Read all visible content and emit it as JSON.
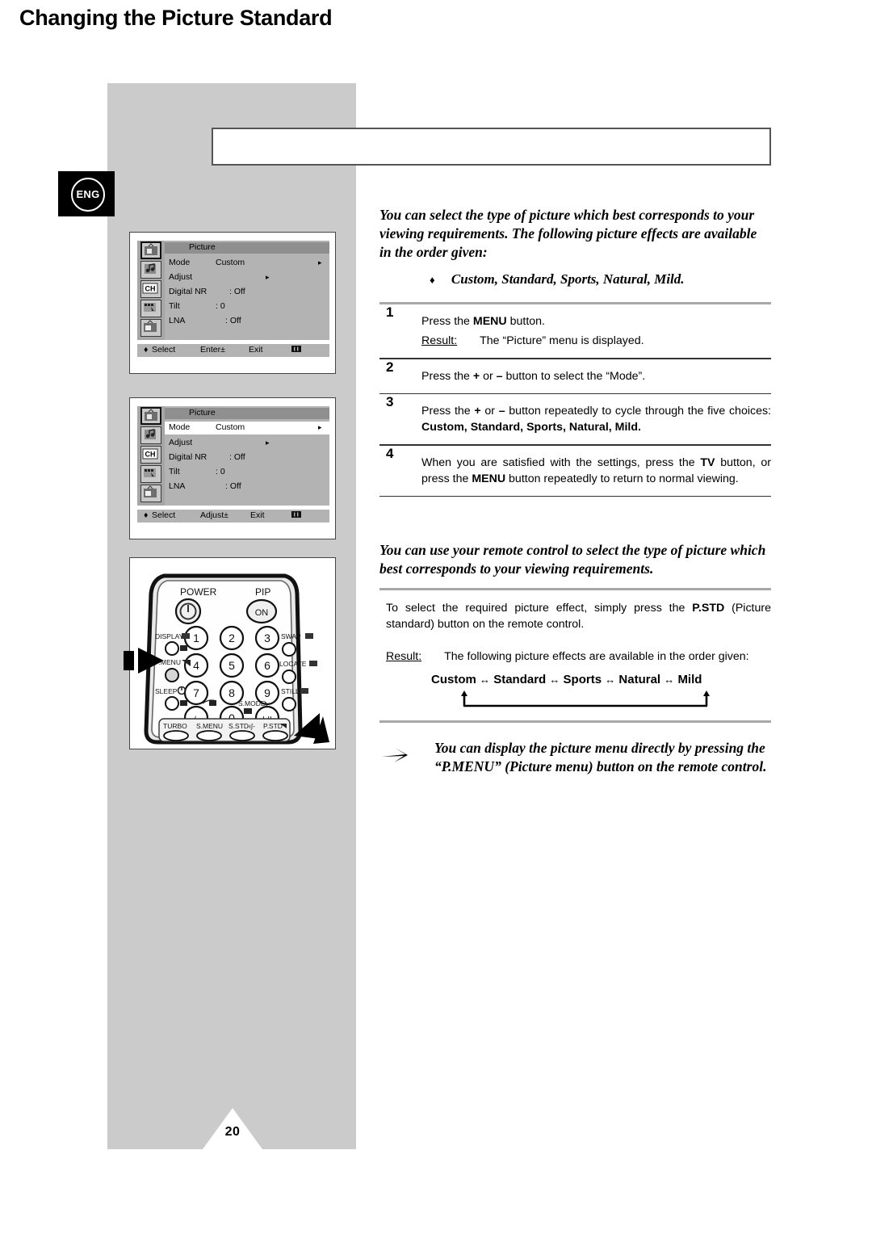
{
  "page": {
    "number": "20",
    "language_badge": "ENG",
    "title": "Changing the Picture Standard"
  },
  "osd_menu_1": {
    "title": "Picture",
    "icons": [
      "picture-icon",
      "sound-icon",
      "channel-icon",
      "function-icon",
      "pip-icon"
    ],
    "rows": [
      {
        "label": "Mode",
        "value": "Custom",
        "arrow": "▸",
        "highlighted": false
      },
      {
        "label": "Adjust",
        "value": "",
        "arrow": "▸",
        "highlighted": false
      },
      {
        "label": "Digital NR",
        "value": ": Off",
        "arrow": "",
        "highlighted": false
      },
      {
        "label": "Tilt",
        "value": ": 0",
        "arrow": "",
        "highlighted": false
      },
      {
        "label": "LNA",
        "value": ": Off",
        "arrow": "",
        "highlighted": false
      }
    ],
    "footer": {
      "select": "Select",
      "action": "Enter±",
      "exit": "Exit"
    }
  },
  "osd_menu_2": {
    "title": "Picture",
    "icons": [
      "picture-icon",
      "sound-icon",
      "channel-icon",
      "function-icon",
      "pip-icon"
    ],
    "rows": [
      {
        "label": "Mode",
        "value": "Custom",
        "arrow": "▸",
        "highlighted": true
      },
      {
        "label": "Adjust",
        "value": "",
        "arrow": "▸",
        "highlighted": false
      },
      {
        "label": "Digital NR",
        "value": ": Off",
        "arrow": "",
        "highlighted": false
      },
      {
        "label": "Tilt",
        "value": ": 0",
        "arrow": "",
        "highlighted": false
      },
      {
        "label": "LNA",
        "value": ": Off",
        "arrow": "",
        "highlighted": false
      }
    ],
    "footer": {
      "select": "Select",
      "action": "Adjust±",
      "exit": "Exit"
    }
  },
  "remote": {
    "power_label": "POWER",
    "pip_label": "PIP",
    "pip_on": "ON",
    "digits": [
      "1",
      "2",
      "3",
      "4",
      "5",
      "6",
      "7",
      "8",
      "9",
      "0"
    ],
    "dash_key": "-/--",
    "iii_key": "I-II",
    "left_labels": [
      "DISPLAY",
      "P.MENU",
      "SLEEP"
    ],
    "right_labels": [
      "SWAP",
      "LOCATE",
      "STILL"
    ],
    "smode_label": "S.MODE",
    "bottom_buttons": [
      "TURBO",
      "S.MENU",
      "S.STD",
      "P.STD"
    ],
    "sstd_suffix": "-ıʃ-",
    "pstd_suffix": "-◢-"
  },
  "intro": {
    "paragraph": "You can select the type of picture which best corresponds to your viewing requirements. The following picture effects are available in the order given:",
    "bullet_glyph": "♦",
    "bullet_text": "Custom, Standard, Sports, Natural, Mild."
  },
  "steps": [
    {
      "num": "1",
      "pre": "Press the ",
      "bold": "MENU",
      "post": " button.",
      "result_label": "Result:",
      "result_text": "The “Picture” menu is displayed."
    },
    {
      "num": "2",
      "text_a": "Press the ",
      "plus": "+",
      "text_b": " or ",
      "minus": "–",
      "text_c": " button to select the “Mode”."
    },
    {
      "num": "3",
      "text_a": "Press the ",
      "plus": "+",
      "text_b": " or ",
      "minus": "–",
      "text_c": " button repeatedly to cycle through the five choices: ",
      "bold_choices": "Custom, Standard, Sports, Natural, Mild."
    },
    {
      "num": "4",
      "text_a": "When you are satisfied with the settings, press the ",
      "bold_tv": "TV",
      "text_b": " button, or press the ",
      "bold_menu": "MENU",
      "text_c": " button repeatedly to return to normal viewing."
    }
  ],
  "remote_section": {
    "intro": "You can use your remote control to select the type of picture which best corresponds to your viewing requirements.",
    "body_a": "To select the required picture effect, simply press the ",
    "body_bold": "P.STD",
    "body_b": " (Picture standard)  button on the remote control.",
    "result_label": "Result:",
    "result_text": "The following picture effects are available in the order given:",
    "cycle": [
      "Custom",
      "Standard",
      "Sports",
      "Natural",
      "Mild"
    ],
    "cycle_separator": "↔"
  },
  "note": {
    "arrow_glyph": "➢",
    "text": "You can display the picture menu directly by pressing the “P.MENU” (Picture menu) button on the remote control."
  }
}
